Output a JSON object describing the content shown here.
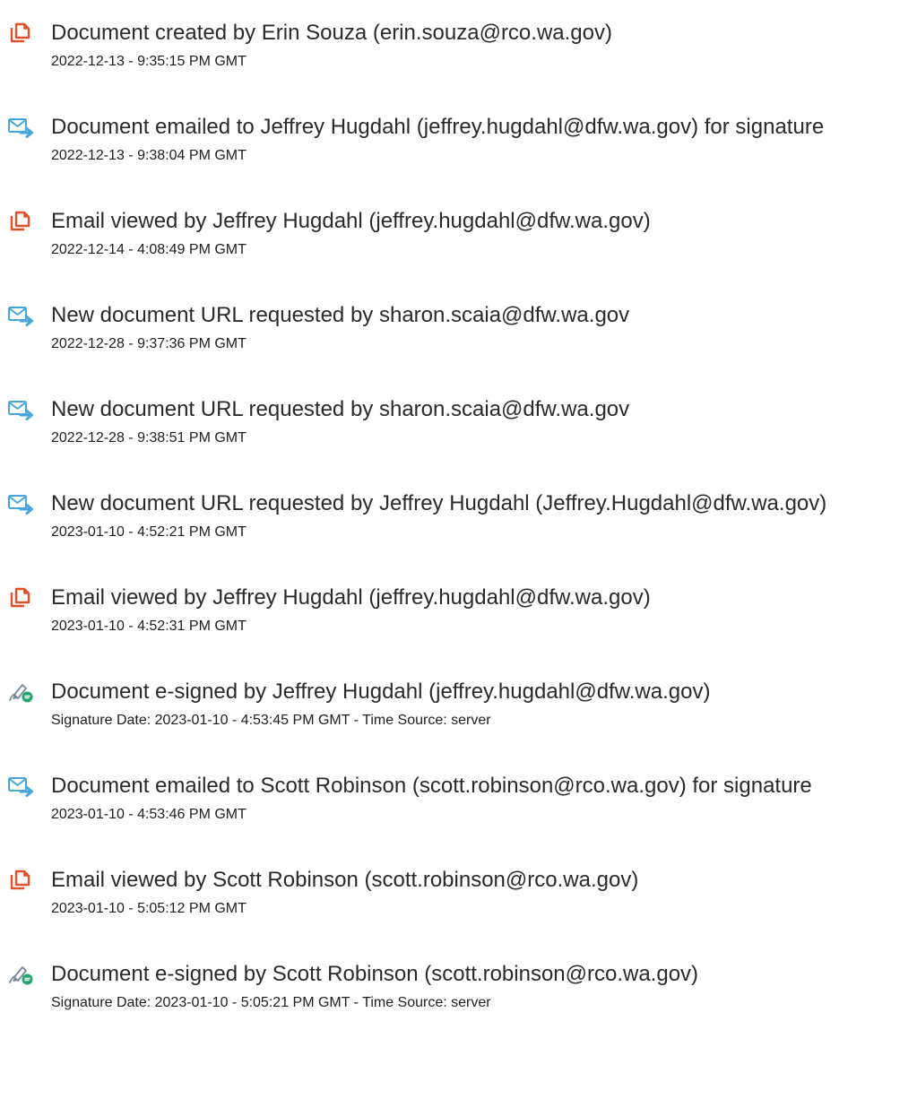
{
  "colors": {
    "doc_icon": "#e0502a",
    "mail_icon": "#47a6dc",
    "sign_icon_pen": "#7a8a99",
    "sign_icon_badge": "#22a86b"
  },
  "events": [
    {
      "icon": "document-icon",
      "title": "Document created by Erin Souza (erin.souza@rco.wa.gov)",
      "sub": "2022-12-13 - 9:35:15 PM GMT"
    },
    {
      "icon": "email-sent-icon",
      "title": "Document emailed to Jeffrey Hugdahl (jeffrey.hugdahl@dfw.wa.gov) for signature",
      "sub": "2022-12-13 - 9:38:04 PM GMT"
    },
    {
      "icon": "document-icon",
      "title": "Email viewed by Jeffrey Hugdahl (jeffrey.hugdahl@dfw.wa.gov)",
      "sub": "2022-12-14 - 4:08:49 PM GMT"
    },
    {
      "icon": "email-sent-icon",
      "title": "New document URL requested by sharon.scaia@dfw.wa.gov",
      "sub": "2022-12-28 - 9:37:36 PM GMT"
    },
    {
      "icon": "email-sent-icon",
      "title": "New document URL requested by sharon.scaia@dfw.wa.gov",
      "sub": "2022-12-28 - 9:38:51 PM GMT"
    },
    {
      "icon": "email-sent-icon",
      "title": "New document URL requested by Jeffrey Hugdahl (Jeffrey.Hugdahl@dfw.wa.gov)",
      "sub": "2023-01-10 - 4:52:21 PM GMT"
    },
    {
      "icon": "document-icon",
      "title": "Email viewed by Jeffrey Hugdahl (jeffrey.hugdahl@dfw.wa.gov)",
      "sub": "2023-01-10 - 4:52:31 PM GMT"
    },
    {
      "icon": "esign-icon",
      "title": "Document e-signed by Jeffrey Hugdahl (jeffrey.hugdahl@dfw.wa.gov)",
      "sub": "Signature Date: 2023-01-10 - 4:53:45 PM GMT - Time Source: server"
    },
    {
      "icon": "email-sent-icon",
      "title": "Document emailed to Scott Robinson (scott.robinson@rco.wa.gov) for signature",
      "sub": "2023-01-10 - 4:53:46 PM GMT"
    },
    {
      "icon": "document-icon",
      "title": "Email viewed by Scott Robinson (scott.robinson@rco.wa.gov)",
      "sub": "2023-01-10 - 5:05:12 PM GMT"
    },
    {
      "icon": "esign-icon",
      "title": "Document e-signed by Scott Robinson (scott.robinson@rco.wa.gov)",
      "sub": "Signature Date: 2023-01-10 - 5:05:21 PM GMT - Time Source: server"
    }
  ]
}
